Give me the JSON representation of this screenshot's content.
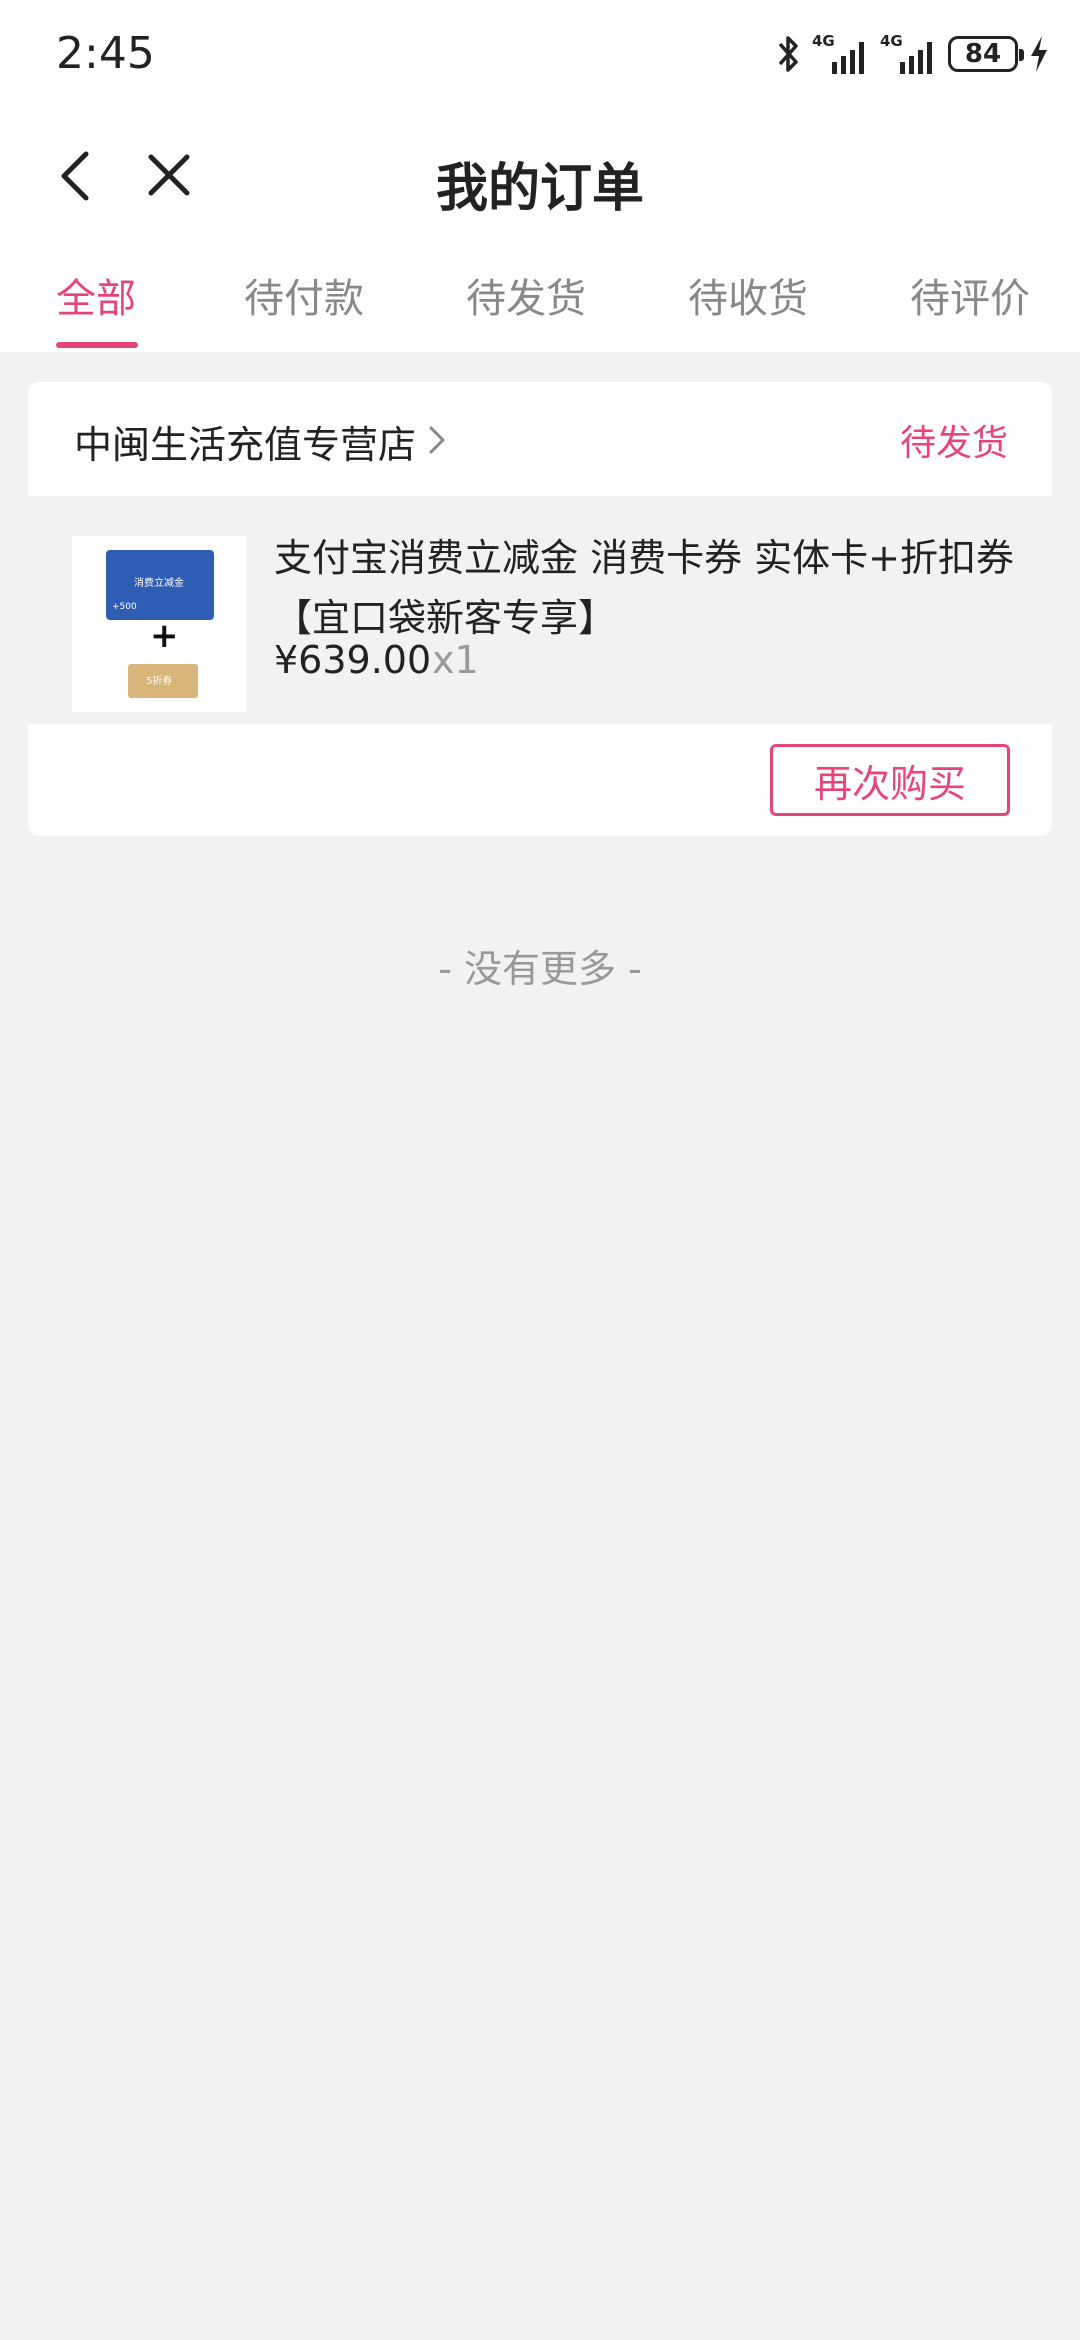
{
  "status_bar": {
    "time": "2:45",
    "network_1": "4G",
    "network_2": "4G",
    "battery": "84",
    "icons": [
      "bluetooth-icon",
      "signal-icon",
      "signal-icon",
      "battery-icon",
      "charging-icon"
    ]
  },
  "nav": {
    "title": "我的订单",
    "back_icon": "chevron-left-icon",
    "close_icon": "close-icon"
  },
  "tabs": [
    {
      "label": "全部",
      "active": true
    },
    {
      "label": "待付款",
      "active": false
    },
    {
      "label": "待发货",
      "active": false
    },
    {
      "label": "待收货",
      "active": false
    },
    {
      "label": "待评价",
      "active": false
    }
  ],
  "order": {
    "shop_name": "中闽生活充值专营店",
    "status": "待发货",
    "product": {
      "title": "支付宝消费立减金 消费卡券 实体卡+折扣券【宜口袋新客专享】",
      "price": "¥639.00",
      "quantity": "x1",
      "thumb": {
        "card_text": "消费立减金",
        "card_value": "+500",
        "plus": "+",
        "coupon_text": "5折券"
      }
    },
    "rebuy_label": "再次购买"
  },
  "footer": {
    "no_more": "- 没有更多 -"
  },
  "colors": {
    "accent": "#e6457a",
    "background": "#f2f2f2"
  }
}
